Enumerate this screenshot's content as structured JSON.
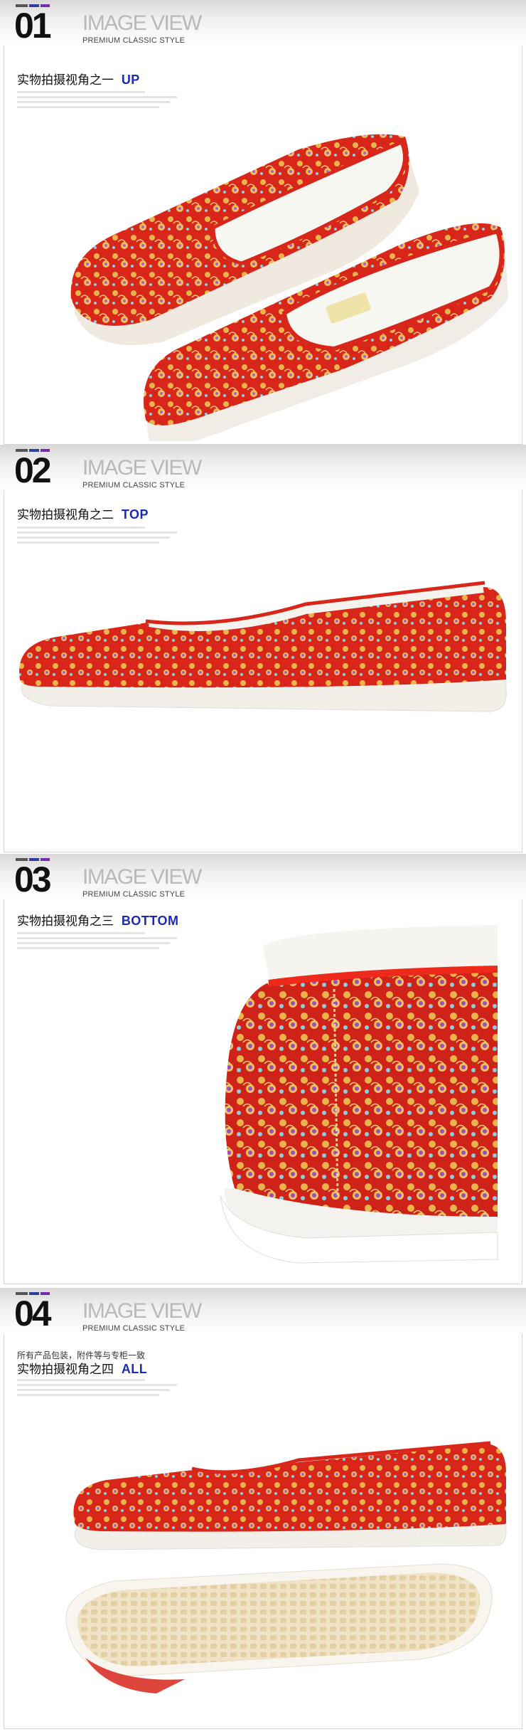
{
  "sections": [
    {
      "number": "01",
      "title": "IMAGE VIEW",
      "subtitle": "PREMIUM CLASSIC STYLE",
      "caption_cn": "实物拍摄视角之一",
      "caption_en": "UP"
    },
    {
      "number": "02",
      "title": "IMAGE VIEW",
      "subtitle": "PREMIUM CLASSIC STYLE",
      "caption_cn": "实物拍摄视角之二",
      "caption_en": "TOP"
    },
    {
      "number": "03",
      "title": "IMAGE VIEW",
      "subtitle": "PREMIUM CLASSIC STYLE",
      "caption_cn": "实物拍摄视角之三",
      "caption_en": "BOTTOM"
    },
    {
      "number": "04",
      "title": "IMAGE VIEW",
      "subtitle": "PREMIUM CLASSIC STYLE",
      "caption_cn": "实物拍摄视角之四",
      "caption_en": "ALL",
      "note": "所有产品包装，附件等与专柜一致"
    }
  ],
  "colors": {
    "caption_accent": "#1b2bb5",
    "header_bar_1": "#555555",
    "header_bar_2": "#2e3fa0",
    "header_bar_3": "#7a2aa8",
    "shoe_red": "#d8261b",
    "pattern_gold": "#e9b54a",
    "sole_white": "#f4f1ec"
  }
}
